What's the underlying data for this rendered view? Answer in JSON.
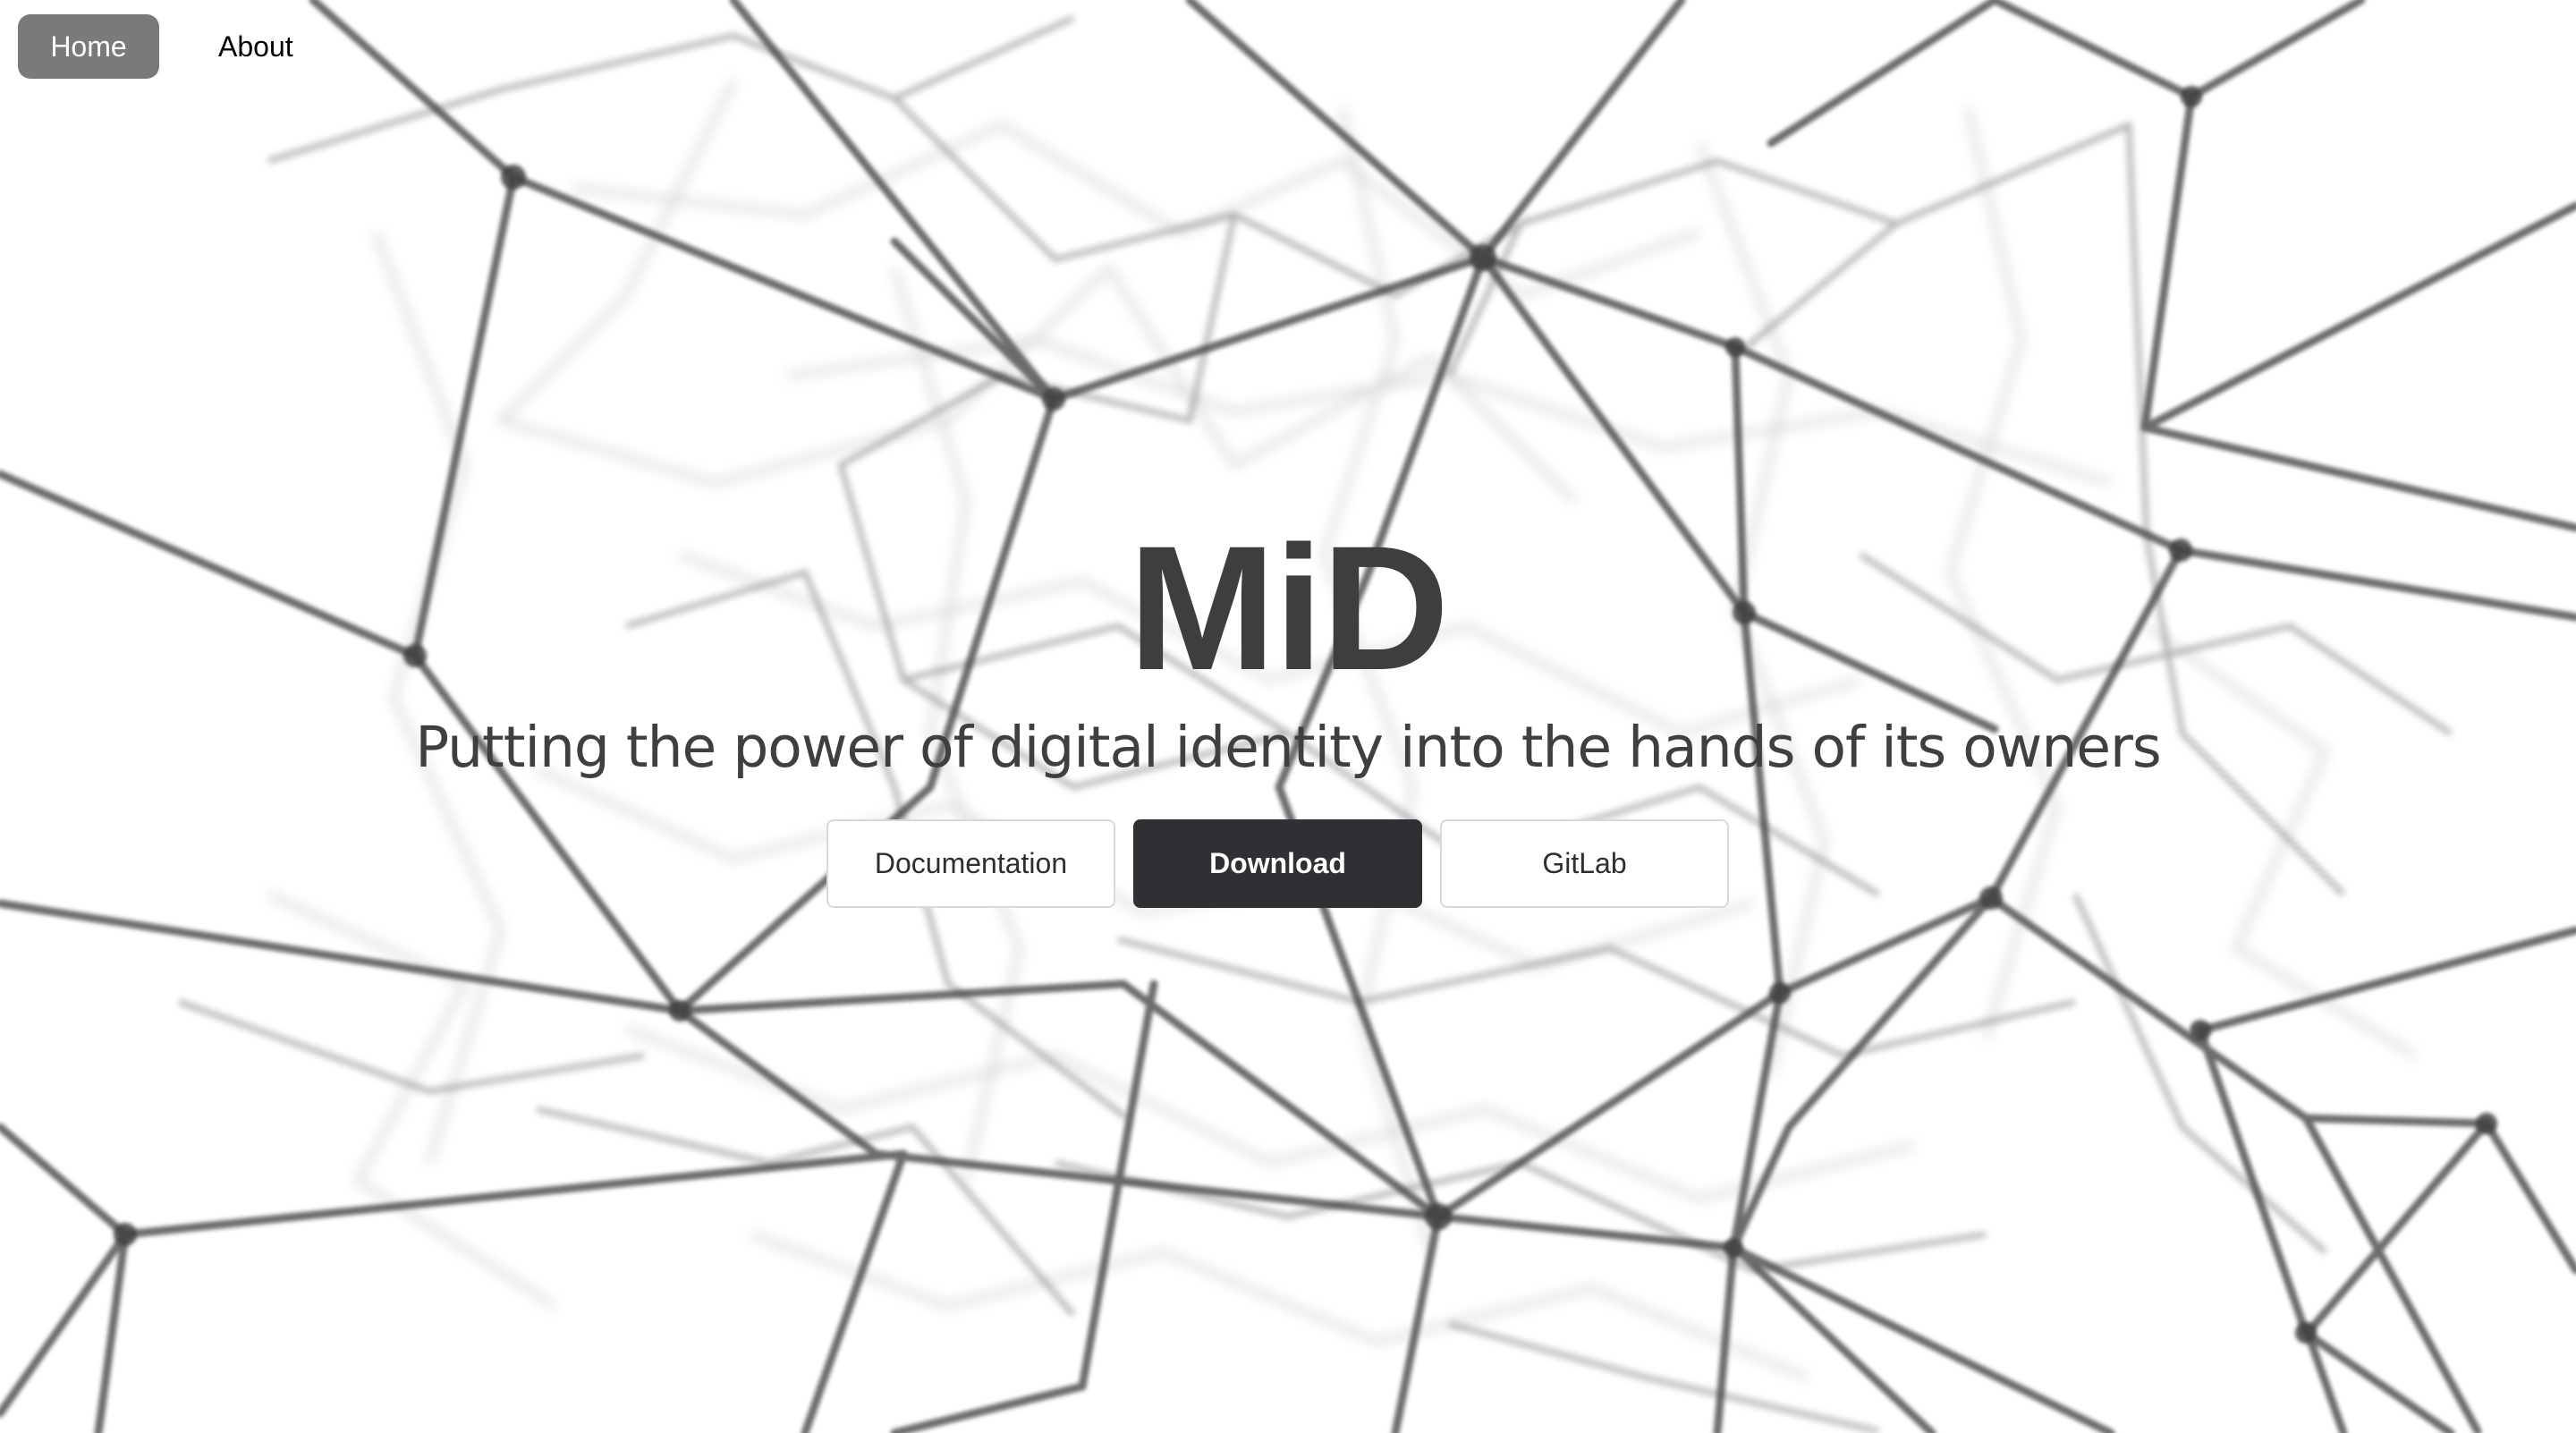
{
  "nav": {
    "items": [
      {
        "label": "Home",
        "active": true
      },
      {
        "label": "About",
        "active": false
      }
    ]
  },
  "hero": {
    "title": "MiD",
    "tagline": "Putting the power of digital identity into the hands of its owners"
  },
  "actions": {
    "documentation_label": "Documentation",
    "download_label": "Download",
    "gitlab_label": "GitLab"
  },
  "colors": {
    "nav_active_bg": "#7a7a7a",
    "primary_button_bg": "#2f3033",
    "title_color": "#3e3e3e",
    "network_line": "#555555"
  },
  "background": {
    "icon": "network-graph"
  }
}
